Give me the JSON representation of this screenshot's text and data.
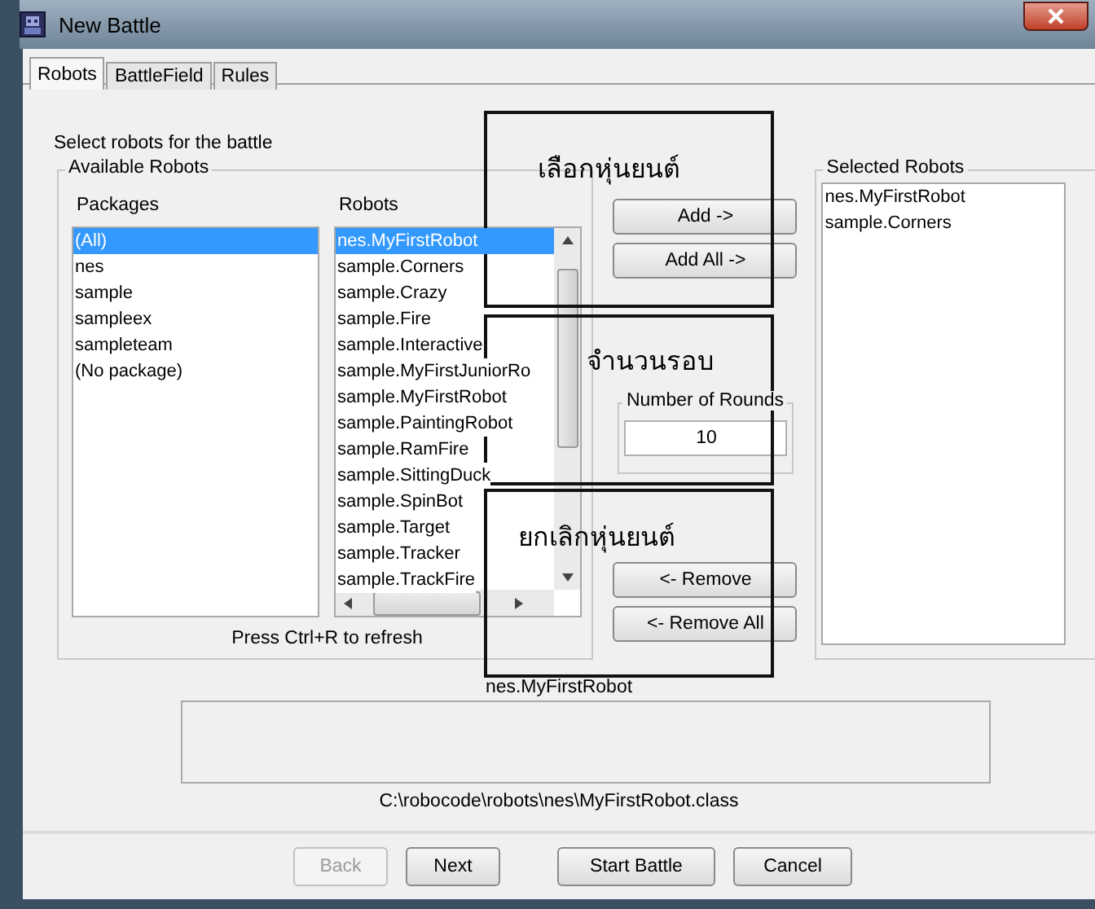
{
  "window": {
    "title": "New Battle"
  },
  "tabs": [
    {
      "label": "Robots",
      "selected": true
    },
    {
      "label": "BattleField",
      "selected": false
    },
    {
      "label": "Rules",
      "selected": false
    }
  ],
  "instruction": "Select robots for the battle",
  "available_robots": {
    "title": "Available Robots",
    "packages": {
      "heading": "Packages",
      "items": [
        {
          "label": "(All)",
          "selected": true
        },
        {
          "label": "nes",
          "selected": false
        },
        {
          "label": "sample",
          "selected": false
        },
        {
          "label": "sampleex",
          "selected": false
        },
        {
          "label": "sampleteam",
          "selected": false
        },
        {
          "label": "(No package)",
          "selected": false
        }
      ]
    },
    "robots": {
      "heading": "Robots",
      "items": [
        {
          "label": "nes.MyFirstRobot",
          "selected": true
        },
        {
          "label": "sample.Corners",
          "selected": false
        },
        {
          "label": "sample.Crazy",
          "selected": false
        },
        {
          "label": "sample.Fire",
          "selected": false
        },
        {
          "label": "sample.Interactive",
          "selected": false
        },
        {
          "label": "sample.MyFirstJuniorRo",
          "selected": false
        },
        {
          "label": "sample.MyFirstRobot",
          "selected": false
        },
        {
          "label": "sample.PaintingRobot",
          "selected": false
        },
        {
          "label": "sample.RamFire",
          "selected": false
        },
        {
          "label": "sample.SittingDuck",
          "selected": false
        },
        {
          "label": "sample.SpinBot",
          "selected": false
        },
        {
          "label": "sample.Target",
          "selected": false
        },
        {
          "label": "sample.Tracker",
          "selected": false
        },
        {
          "label": "sample.TrackFire",
          "selected": false
        }
      ]
    },
    "refresh_hint": "Press Ctrl+R to refresh"
  },
  "add_buttons": [
    {
      "label": "Add ->",
      "disabled": false
    },
    {
      "label": "Add All ->",
      "disabled": false
    }
  ],
  "rounds": {
    "title": "Number of Rounds",
    "value": "10"
  },
  "remove_buttons": [
    {
      "label": "<- Remove",
      "disabled": false
    },
    {
      "label": "<- Remove All",
      "disabled": false
    }
  ],
  "selected_robots": {
    "title": "Selected Robots",
    "items": [
      {
        "label": "nes.MyFirstRobot"
      },
      {
        "label": "sample.Corners"
      }
    ]
  },
  "robot_name": "nes.MyFirstRobot",
  "robot_path": "C:\\robocode\\robots\\nes\\MyFirstRobot.class",
  "footer_buttons": [
    {
      "label": "Back",
      "disabled": true
    },
    {
      "label": "Next",
      "disabled": false
    },
    {
      "label": "Start Battle",
      "disabled": false
    },
    {
      "label": "Cancel",
      "disabled": false
    }
  ],
  "annotations": [
    {
      "label": "เลือกหุ่นยนต์",
      "kind": "select"
    },
    {
      "label": "จำนวนรอบ",
      "kind": "rounds"
    },
    {
      "label": "ยกเลิกหุ่นยนต์",
      "kind": "remove"
    }
  ]
}
